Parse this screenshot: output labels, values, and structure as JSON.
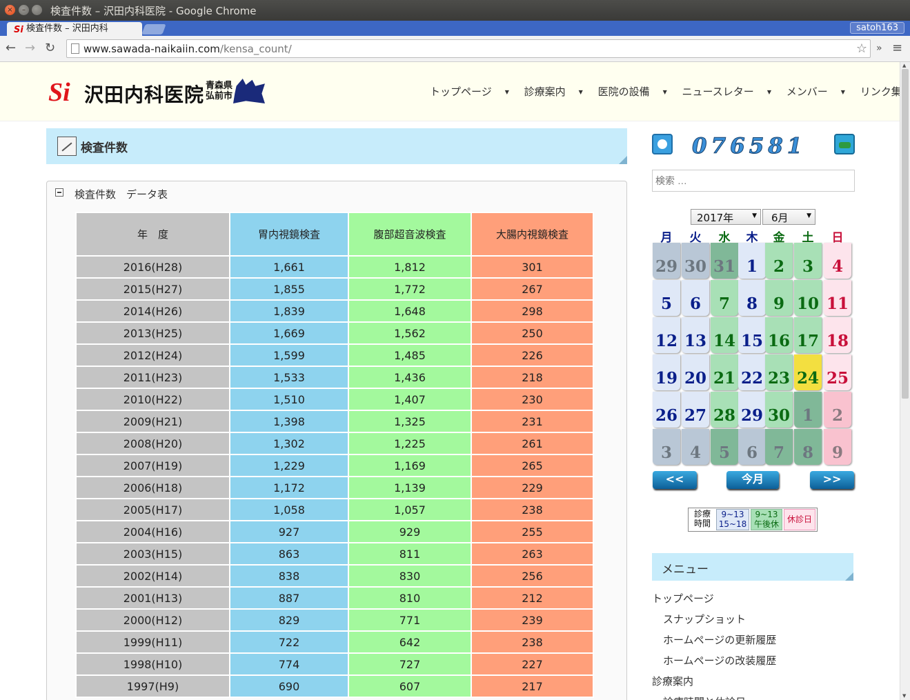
{
  "window": {
    "title": "検査件数 – 沢田内科医院 - Google Chrome",
    "close_glyph": "×",
    "min_glyph": "–",
    "max_glyph": ""
  },
  "browser": {
    "tab_title": "検査件数 – 沢田内科",
    "tab_favicon": "Si",
    "profile": "satoh163",
    "url_host": "www.sawada-naikaiin.com",
    "url_path": "/kensa_count/",
    "back": "←",
    "forward": "→",
    "reload": "↻",
    "star": "☆",
    "more": "»",
    "menu": "≡"
  },
  "site": {
    "logo_mark": "Si",
    "logo_name": "沢田内科医院",
    "logo_pref": "青森県",
    "logo_city": "弘前市",
    "nav": [
      "トップページ",
      "診療案内",
      "医院の設備",
      "ニュースレター",
      "メンバー",
      "リンク集"
    ]
  },
  "main": {
    "heading": "検査件数",
    "box_label": "検査件数　データ表",
    "table": {
      "headers": [
        "年　度",
        "胃内視鏡検査",
        "腹部超音波検査",
        "大腸内視鏡検査"
      ],
      "rows": [
        [
          "2016(H28)",
          "1,661",
          "1,812",
          "301"
        ],
        [
          "2015(H27)",
          "1,855",
          "1,772",
          "267"
        ],
        [
          "2014(H26)",
          "1,839",
          "1,648",
          "298"
        ],
        [
          "2013(H25)",
          "1,669",
          "1,562",
          "250"
        ],
        [
          "2012(H24)",
          "1,599",
          "1,485",
          "226"
        ],
        [
          "2011(H23)",
          "1,533",
          "1,436",
          "218"
        ],
        [
          "2010(H22)",
          "1,510",
          "1,407",
          "230"
        ],
        [
          "2009(H21)",
          "1,398",
          "1,325",
          "231"
        ],
        [
          "2008(H20)",
          "1,302",
          "1,225",
          "261"
        ],
        [
          "2007(H19)",
          "1,229",
          "1,169",
          "265"
        ],
        [
          "2006(H18)",
          "1,172",
          "1,139",
          "229"
        ],
        [
          "2005(H17)",
          "1,058",
          "1,057",
          "238"
        ],
        [
          "2004(H16)",
          "927",
          "929",
          "255"
        ],
        [
          "2003(H15)",
          "863",
          "811",
          "263"
        ],
        [
          "2002(H14)",
          "838",
          "830",
          "256"
        ],
        [
          "2001(H13)",
          "887",
          "810",
          "212"
        ],
        [
          "2000(H12)",
          "829",
          "771",
          "239"
        ],
        [
          "1999(H11)",
          "722",
          "642",
          "238"
        ],
        [
          "1998(H10)",
          "774",
          "727",
          "227"
        ],
        [
          "1997(H9)",
          "690",
          "607",
          "217"
        ]
      ]
    }
  },
  "sidebar": {
    "counter": "076581",
    "search_placeholder": "検索 …",
    "year": "2017年",
    "month": "6月",
    "weekdays": [
      "月",
      "火",
      "水",
      "木",
      "金",
      "土",
      "日"
    ],
    "weekday_colors": [
      "#0a1f8a",
      "#0a1f8a",
      "#0a6a12",
      "#0a1f8a",
      "#0a6a12",
      "#0a6a12",
      "#c8103a"
    ],
    "calendar": [
      [
        [
          "29",
          "ow"
        ],
        [
          "30",
          "ow"
        ],
        [
          "31",
          "og"
        ],
        [
          "1",
          "dw"
        ],
        [
          "2",
          "dg"
        ],
        [
          "3",
          "dg"
        ],
        [
          "4",
          "dh"
        ]
      ],
      [
        [
          "5",
          "dw"
        ],
        [
          "6",
          "dw"
        ],
        [
          "7",
          "dg"
        ],
        [
          "8",
          "dw"
        ],
        [
          "9",
          "dg"
        ],
        [
          "10",
          "dg"
        ],
        [
          "11",
          "dh"
        ]
      ],
      [
        [
          "12",
          "dw"
        ],
        [
          "13",
          "dw"
        ],
        [
          "14",
          "dg"
        ],
        [
          "15",
          "dw"
        ],
        [
          "16",
          "dg"
        ],
        [
          "17",
          "dg"
        ],
        [
          "18",
          "dh"
        ]
      ],
      [
        [
          "19",
          "dw"
        ],
        [
          "20",
          "dw"
        ],
        [
          "21",
          "dg"
        ],
        [
          "22",
          "dw"
        ],
        [
          "23",
          "dg"
        ],
        [
          "24",
          "dt"
        ],
        [
          "25",
          "dh"
        ]
      ],
      [
        [
          "26",
          "dw"
        ],
        [
          "27",
          "dw"
        ],
        [
          "28",
          "dg"
        ],
        [
          "29",
          "dw"
        ],
        [
          "30",
          "dg"
        ],
        [
          "1",
          "og"
        ],
        [
          "2",
          "oh"
        ]
      ],
      [
        [
          "3",
          "ow"
        ],
        [
          "4",
          "ow"
        ],
        [
          "5",
          "og"
        ],
        [
          "6",
          "ow"
        ],
        [
          "7",
          "og"
        ],
        [
          "8",
          "og"
        ],
        [
          "9",
          "oh"
        ]
      ]
    ],
    "prev": "<<",
    "today": "今月",
    "next": ">>",
    "legend": {
      "label": "診療\n時間",
      "normal": "9~13\n15~18",
      "afternoon_off": "9~13\n午後休",
      "holiday": "休診日"
    },
    "menu_title": "メニュー",
    "menu_items": [
      {
        "label": "トップページ",
        "indent": 0
      },
      {
        "label": "スナップショット",
        "indent": 1
      },
      {
        "label": "ホームページの更新履歴",
        "indent": 1
      },
      {
        "label": "ホームページの改装履歴",
        "indent": 1
      },
      {
        "label": "診療案内",
        "indent": 0
      },
      {
        "label": "診療時間と休診日",
        "indent": 1
      }
    ]
  }
}
